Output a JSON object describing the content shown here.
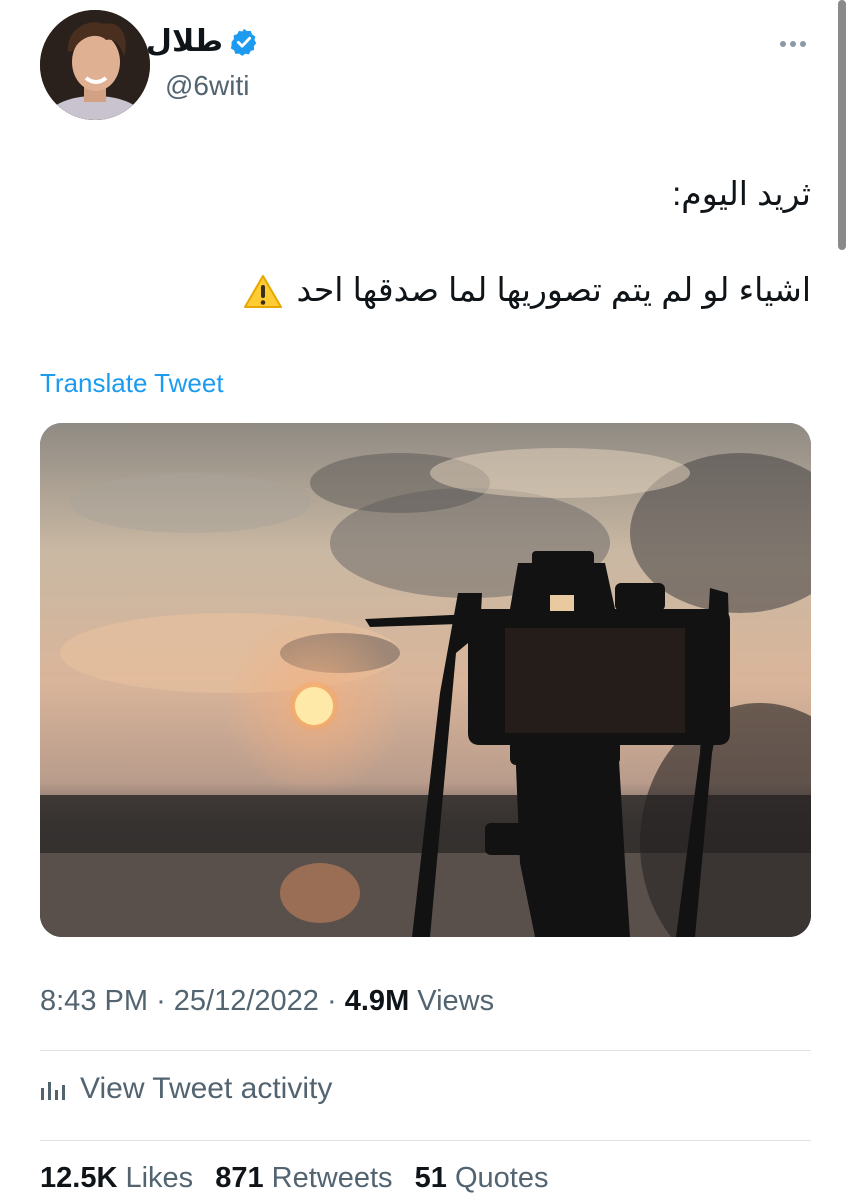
{
  "author": {
    "display_name": "طلال",
    "handle": "@6witi",
    "verified": true
  },
  "tweet": {
    "line1": "ثريد اليوم:",
    "line2": "اشياء لو لم يتم تصوريها لما صدقها احد",
    "emoji_icon": "warning-icon"
  },
  "translate_label": "Translate Tweet",
  "meta": {
    "time": "8:43 PM",
    "separator": "·",
    "date": "25/12/2022",
    "views_count": "4.9M",
    "views_label": "Views"
  },
  "activity": {
    "label": "View Tweet activity",
    "icon": "bar-chart-icon"
  },
  "stats": {
    "likes_count": "12.5K",
    "likes_label": "Likes",
    "retweets_count": "871",
    "retweets_label": "Retweets",
    "quotes_count": "51",
    "quotes_label": "Quotes"
  },
  "colors": {
    "link": "#1d9bf0",
    "secondary_text": "#536471",
    "verified_badge": "#1d9bf0"
  }
}
